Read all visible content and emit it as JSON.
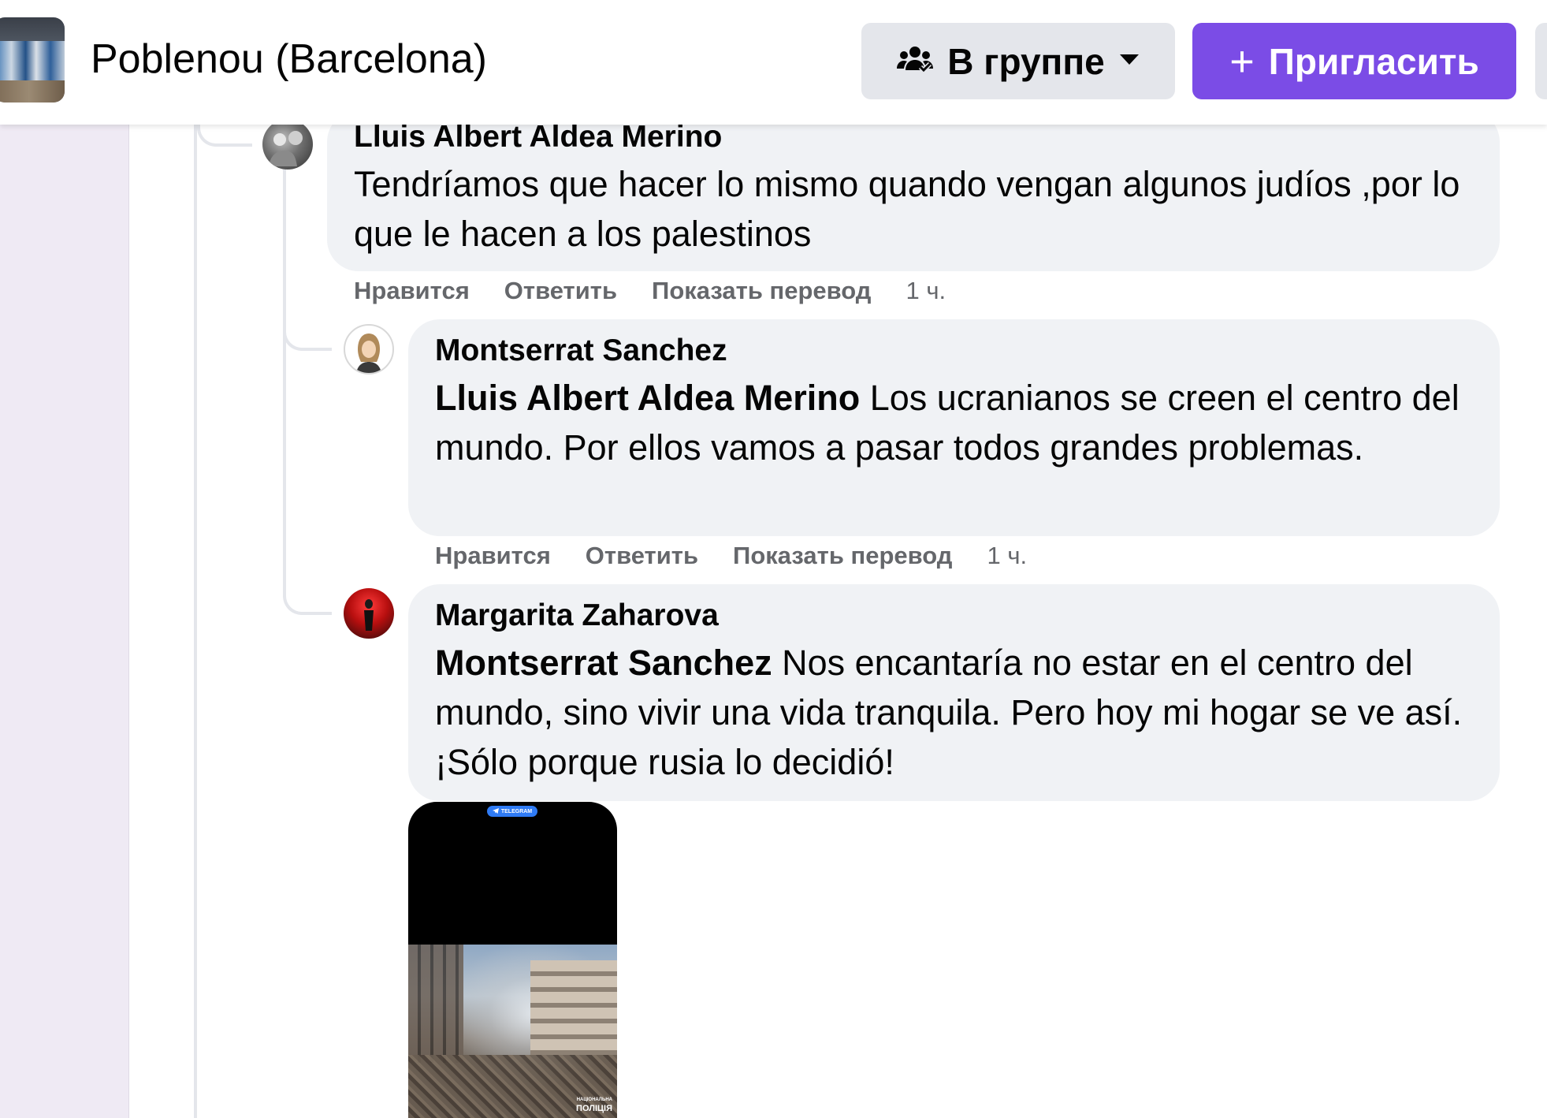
{
  "header": {
    "group_name": "Poblenou (Barcelona)",
    "membership_button": "В группе",
    "invite_button": "Пригласить",
    "invite_plus": "+"
  },
  "comments": [
    {
      "author": "Lluis Albert Aldea Merino",
      "mention": "",
      "text": "Tendríamos que hacer lo mismo quando vengan algunos judíos ,por lo que le hacen a los palestinos",
      "actions": {
        "like": "Нравится",
        "reply": "Ответить",
        "translate": "Показать перевод",
        "time": "1 ч."
      }
    },
    {
      "author": "Montserrat Sanchez",
      "mention": "Lluis Albert Aldea Merino",
      "text": " Los ucranianos se creen el centro del mundo. Por ellos vamos a pasar todos grandes problemas.",
      "actions": {
        "like": "Нравится",
        "reply": "Ответить",
        "translate": "Показать перевод",
        "time": "1 ч."
      }
    },
    {
      "author": "Margarita Zaharova",
      "mention": "Montserrat Sanchez",
      "text": " Nos encantaría no estar en el centro del mundo, sino vivir una vida tranquila. Pero hoy mi hogar se ve así. ¡Sólo porque rusia lo decidió!"
    }
  ],
  "attachment": {
    "badge": "TELEGRAM",
    "watermark_small": "НАЦІОНАЛЬНА",
    "watermark": "ПОЛІЦІЯ"
  },
  "colors": {
    "accent": "#7b4ce6",
    "bubble": "#f0f2f5",
    "secondary_text": "#65676b",
    "button_gray": "#e4e6eb"
  },
  "icons": [
    "group-members-icon",
    "caret-down-icon",
    "plus-icon",
    "telegram-icon"
  ]
}
